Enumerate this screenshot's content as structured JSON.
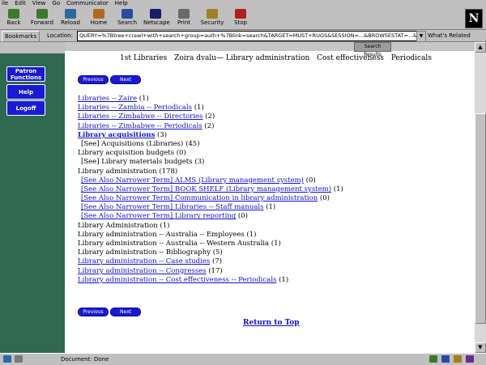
{
  "browser": {
    "menus": [
      "ile",
      "Edit",
      "View",
      "Go",
      "Communicator",
      "Help"
    ],
    "toolbar": [
      {
        "label": "Back",
        "icon": "back-icon",
        "color": "#3a7a2a"
      },
      {
        "label": "Forward",
        "icon": "forward-icon",
        "color": "#3a7a2a"
      },
      {
        "label": "Reload",
        "icon": "reload-icon",
        "color": "#2a6aa0"
      },
      {
        "label": "Home",
        "icon": "home-icon",
        "color": "#b06a20"
      },
      {
        "label": "Search",
        "icon": "search-icon",
        "color": "#2a4aa0"
      },
      {
        "label": "Netscape",
        "icon": "netscape-icon",
        "color": "#1a1a6a"
      },
      {
        "label": "Print",
        "icon": "print-icon",
        "color": "#6a6a6a"
      },
      {
        "label": "Security",
        "icon": "security-icon",
        "color": "#a08020"
      },
      {
        "label": "Stop",
        "icon": "stop-icon",
        "color": "#b02020"
      }
    ],
    "bookmarks_label": "Bookmarks",
    "location_label": "Location:",
    "location_url": "QUERY=%7Btree+crawl+with+search+group=auth+%7Blink=search&TARGET=MUST+RUGS&SESSION=...&BROWSESTAT=...&COUNT=570...",
    "related_label": "What's Related",
    "status_text": "Document: Done"
  },
  "sidebar": {
    "buttons": [
      "Patron Functions",
      "Help",
      "Logoff"
    ]
  },
  "page": {
    "top_button": "Search Results",
    "tabs": [
      "1st Libraries",
      "Zoira dvalu— Library administration",
      "Cost effectiveness",
      "Periodicals"
    ],
    "nav_prev": "Previous",
    "nav_next": "Next",
    "rows": [
      {
        "text": "Libraries -- Zaire",
        "count": " (1)",
        "link": true,
        "bold": false
      },
      {
        "text": "Libraries -- Zambia -- Periodicals",
        "count": " (1)",
        "link": true,
        "bold": false
      },
      {
        "text": "Libraries -- Zimbabwe -- Directories",
        "count": " (2)",
        "link": true,
        "bold": false
      },
      {
        "text": "Libraries -- Zimbabwe -- Periodicals",
        "count": " (2)",
        "link": true,
        "bold": false
      },
      {
        "text": "Library acquisitions",
        "count": " (3)",
        "link": true,
        "bold": true
      },
      {
        "text": "[See] Acquisitions (Libraries)",
        "count": " (45)",
        "link": false,
        "indent": true,
        "bold": false
      },
      {
        "text": "Library acquisition budgets",
        "count": " (0)",
        "link": false,
        "bold": false
      },
      {
        "text": "[See] Library materials budgets",
        "count": " (3)",
        "link": false,
        "indent": true,
        "bold": false
      },
      {
        "text": "Library administration",
        "count": " (178)",
        "link": false,
        "bold": false
      },
      {
        "text": "[See Also Narrower Term] ALMS (Library management system)",
        "count": " (0)",
        "link": true,
        "indent": true,
        "bold": false
      },
      {
        "text": "[See Also Narrower Term] BOOK SHELF (Library management system)",
        "count": " (1)",
        "link": true,
        "indent": true,
        "bold": false
      },
      {
        "text": "[See Also Narrower Term] Communication in library administration",
        "count": " (0)",
        "link": true,
        "indent": true,
        "bold": false
      },
      {
        "text": "[See Also Narrower Term] Libraries -- Staff manuals",
        "count": " (1)",
        "link": true,
        "indent": true,
        "bold": false
      },
      {
        "text": "[See Also Narrower Term] Library reporting",
        "count": " (0)",
        "link": true,
        "indent": true,
        "bold": false
      },
      {
        "text": "Library Administration",
        "count": " (1)",
        "link": false,
        "bold": false
      },
      {
        "text": "Library administration -- Australia -- Employees",
        "count": " (1)",
        "link": false,
        "bold": false
      },
      {
        "text": "Library administration -- Australia -- Western Australia",
        "count": " (1)",
        "link": false,
        "bold": false
      },
      {
        "text": "Library administration -- Bibliography",
        "count": " (5)",
        "link": false,
        "bold": false
      },
      {
        "text": "Library administration -- Case studies",
        "count": " (7)",
        "link": true,
        "bold": false
      },
      {
        "text": "Library administration -- Congresses",
        "count": " (17)",
        "link": true,
        "bold": false
      },
      {
        "text": "Library administration -- Cost effectiveness -- Periodicals",
        "count": " (1)",
        "link": true,
        "bold": false
      }
    ],
    "return_label": "Return to Top"
  },
  "colors": {
    "sidebar_bg": "#2f6a50",
    "button_blue": "#1a1ad6",
    "link": "#1111cc"
  }
}
